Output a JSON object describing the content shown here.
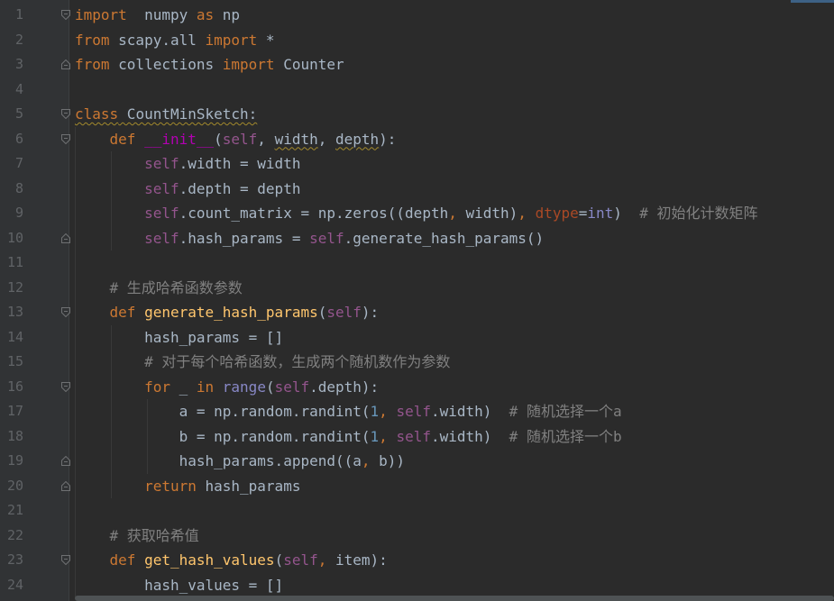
{
  "editor": {
    "lines": [
      {
        "n": "1",
        "tokens": [
          [
            "kw",
            "import"
          ],
          [
            "",
            "  numpy "
          ],
          [
            "kw",
            "as"
          ],
          [
            "",
            " np"
          ]
        ]
      },
      {
        "n": "2",
        "tokens": [
          [
            "kw",
            "from"
          ],
          [
            "",
            " scapy.all "
          ],
          [
            "kw",
            "import"
          ],
          [
            "",
            " *"
          ]
        ]
      },
      {
        "n": "3",
        "tokens": [
          [
            "kw",
            "from"
          ],
          [
            "",
            " collections "
          ],
          [
            "kw",
            "import"
          ],
          [
            "",
            " Counter"
          ]
        ]
      },
      {
        "n": "4",
        "tokens": []
      },
      {
        "n": "5",
        "tokens": [
          [
            "kw squig",
            "class"
          ],
          [
            "squig",
            " CountMinSketch:"
          ]
        ]
      },
      {
        "n": "6",
        "tokens": [
          [
            "",
            "    "
          ],
          [
            "kw",
            "def "
          ],
          [
            "magic",
            "__init__"
          ],
          [
            "",
            "("
          ],
          [
            "self",
            "self"
          ],
          [
            "",
            ", "
          ],
          [
            "squig",
            "width"
          ],
          [
            "",
            ", "
          ],
          [
            "squig",
            "depth"
          ],
          [
            "",
            "):"
          ]
        ]
      },
      {
        "n": "7",
        "tokens": [
          [
            "",
            "        "
          ],
          [
            "self",
            "self"
          ],
          [
            "",
            ".width = width"
          ]
        ]
      },
      {
        "n": "8",
        "tokens": [
          [
            "",
            "        "
          ],
          [
            "self",
            "self"
          ],
          [
            "",
            ".depth = depth"
          ]
        ]
      },
      {
        "n": "9",
        "tokens": [
          [
            "",
            "        "
          ],
          [
            "self",
            "self"
          ],
          [
            "",
            ".count_matrix = np.zeros((depth"
          ],
          [
            "kw",
            ","
          ],
          [
            "",
            " width)"
          ],
          [
            "kw",
            ","
          ],
          [
            "",
            " "
          ],
          [
            "param",
            "dtype"
          ],
          [
            "",
            "="
          ],
          [
            "builtin",
            "int"
          ],
          [
            "",
            ")  "
          ],
          [
            "cm",
            "# 初始化计数矩阵"
          ]
        ]
      },
      {
        "n": "10",
        "tokens": [
          [
            "",
            "        "
          ],
          [
            "self",
            "self"
          ],
          [
            "",
            ".hash_params = "
          ],
          [
            "self",
            "self"
          ],
          [
            "",
            ".generate_hash_params()"
          ]
        ]
      },
      {
        "n": "11",
        "tokens": []
      },
      {
        "n": "12",
        "tokens": [
          [
            "",
            "    "
          ],
          [
            "cm",
            "# 生成哈希函数参数"
          ]
        ]
      },
      {
        "n": "13",
        "tokens": [
          [
            "",
            "    "
          ],
          [
            "kw",
            "def "
          ],
          [
            "fn",
            "generate_hash_params"
          ],
          [
            "",
            "("
          ],
          [
            "self",
            "self"
          ],
          [
            "",
            "):"
          ]
        ]
      },
      {
        "n": "14",
        "tokens": [
          [
            "",
            "        hash_params = []"
          ]
        ]
      },
      {
        "n": "15",
        "tokens": [
          [
            "",
            "        "
          ],
          [
            "cm",
            "# 对于每个哈希函数，生成两个随机数作为参数"
          ]
        ]
      },
      {
        "n": "16",
        "tokens": [
          [
            "",
            "        "
          ],
          [
            "kw",
            "for"
          ],
          [
            "",
            " _ "
          ],
          [
            "kw",
            "in"
          ],
          [
            "",
            " "
          ],
          [
            "builtin",
            "range"
          ],
          [
            "",
            "("
          ],
          [
            "self",
            "self"
          ],
          [
            "",
            ".depth):"
          ]
        ]
      },
      {
        "n": "17",
        "tokens": [
          [
            "",
            "            a = np.random.randint("
          ],
          [
            "num",
            "1"
          ],
          [
            "kw",
            ","
          ],
          [
            "",
            " "
          ],
          [
            "self",
            "self"
          ],
          [
            "",
            ".width)  "
          ],
          [
            "cm",
            "# 随机选择一个a"
          ]
        ]
      },
      {
        "n": "18",
        "tokens": [
          [
            "",
            "            b = np.random.randint("
          ],
          [
            "num",
            "1"
          ],
          [
            "kw",
            ","
          ],
          [
            "",
            " "
          ],
          [
            "self",
            "self"
          ],
          [
            "",
            ".width)  "
          ],
          [
            "cm",
            "# 随机选择一个b"
          ]
        ]
      },
      {
        "n": "19",
        "tokens": [
          [
            "",
            "            hash_params.append((a"
          ],
          [
            "kw",
            ","
          ],
          [
            "",
            " b))"
          ]
        ]
      },
      {
        "n": "20",
        "tokens": [
          [
            "",
            "        "
          ],
          [
            "kw",
            "return"
          ],
          [
            "",
            " hash_params"
          ]
        ]
      },
      {
        "n": "21",
        "tokens": []
      },
      {
        "n": "22",
        "tokens": [
          [
            "",
            "    "
          ],
          [
            "cm",
            "# 获取哈希值"
          ]
        ]
      },
      {
        "n": "23",
        "tokens": [
          [
            "",
            "    "
          ],
          [
            "kw",
            "def "
          ],
          [
            "fn",
            "get_hash_values"
          ],
          [
            "",
            "("
          ],
          [
            "self",
            "self"
          ],
          [
            "kw",
            ","
          ],
          [
            "",
            " item):"
          ]
        ]
      },
      {
        "n": "24",
        "tokens": [
          [
            "",
            "        hash_values = []"
          ]
        ]
      }
    ],
    "folds": {
      "1": "open",
      "3": "close",
      "5": "open",
      "6": "open",
      "10": "close",
      "13": "open",
      "16": "open",
      "19": "close",
      "20": "close",
      "23": "open"
    }
  },
  "colors": {
    "background": "#2b2b2b",
    "keyword": "#cc7832",
    "function": "#ffc66d",
    "self": "#94558d",
    "number": "#6897bb",
    "comment": "#808080",
    "default": "#a9b7c6"
  }
}
